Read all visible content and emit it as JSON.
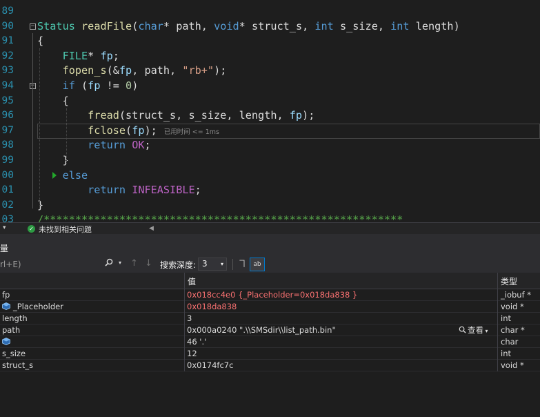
{
  "editor": {
    "lines": [
      {
        "num": "89",
        "tokens": []
      },
      {
        "num": "90",
        "tokens": [
          {
            "t": "Status",
            "c": "t"
          },
          {
            "t": " ",
            "c": ""
          },
          {
            "t": "readFile",
            "c": "f"
          },
          {
            "t": "(",
            "c": ""
          },
          {
            "t": "char",
            "c": "k"
          },
          {
            "t": "* path, ",
            "c": ""
          },
          {
            "t": "void",
            "c": "k"
          },
          {
            "t": "* struct_s, ",
            "c": ""
          },
          {
            "t": "int",
            "c": "k"
          },
          {
            "t": " s_size, ",
            "c": ""
          },
          {
            "t": "int",
            "c": "k"
          },
          {
            "t": " length)",
            "c": ""
          }
        ]
      },
      {
        "num": "91",
        "tokens": [
          {
            "t": "{",
            "c": ""
          }
        ]
      },
      {
        "num": "92",
        "tokens": [
          {
            "t": "    ",
            "c": ""
          },
          {
            "t": "FILE",
            "c": "t"
          },
          {
            "t": "* ",
            "c": ""
          },
          {
            "t": "fp",
            "c": "p"
          },
          {
            "t": ";",
            "c": ""
          }
        ]
      },
      {
        "num": "93",
        "tokens": [
          {
            "t": "    ",
            "c": ""
          },
          {
            "t": "fopen_s",
            "c": "f"
          },
          {
            "t": "(&",
            "c": ""
          },
          {
            "t": "fp",
            "c": "p"
          },
          {
            "t": ", path, ",
            "c": ""
          },
          {
            "t": "\"rb+\"",
            "c": "s"
          },
          {
            "t": ");",
            "c": ""
          }
        ]
      },
      {
        "num": "94",
        "tokens": [
          {
            "t": "    ",
            "c": ""
          },
          {
            "t": "if",
            "c": "k"
          },
          {
            "t": " (",
            "c": ""
          },
          {
            "t": "fp",
            "c": "p"
          },
          {
            "t": " != ",
            "c": ""
          },
          {
            "t": "0",
            "c": "n"
          },
          {
            "t": ")",
            "c": ""
          }
        ]
      },
      {
        "num": "95",
        "tokens": [
          {
            "t": "    {",
            "c": ""
          }
        ]
      },
      {
        "num": "96",
        "tokens": [
          {
            "t": "        ",
            "c": ""
          },
          {
            "t": "fread",
            "c": "f"
          },
          {
            "t": "(struct_s, s_size, length, ",
            "c": ""
          },
          {
            "t": "fp",
            "c": "p"
          },
          {
            "t": ");",
            "c": ""
          }
        ]
      },
      {
        "num": "97",
        "tokens": [
          {
            "t": "        ",
            "c": ""
          },
          {
            "t": "fclose",
            "c": "f"
          },
          {
            "t": "(",
            "c": ""
          },
          {
            "t": "fp",
            "c": "p"
          },
          {
            "t": ");",
            "c": ""
          }
        ],
        "hint": "已用时间 <= 1ms"
      },
      {
        "num": "98",
        "tokens": [
          {
            "t": "        ",
            "c": ""
          },
          {
            "t": "return",
            "c": "k"
          },
          {
            "t": " ",
            "c": ""
          },
          {
            "t": "OK",
            "c": "m"
          },
          {
            "t": ";",
            "c": ""
          }
        ]
      },
      {
        "num": "99",
        "tokens": [
          {
            "t": "    }",
            "c": ""
          }
        ]
      },
      {
        "num": "00",
        "tokens": [
          {
            "t": "    ",
            "c": ""
          },
          {
            "t": "else",
            "c": "k"
          }
        ]
      },
      {
        "num": "01",
        "tokens": [
          {
            "t": "        ",
            "c": ""
          },
          {
            "t": "return",
            "c": "k"
          },
          {
            "t": " ",
            "c": ""
          },
          {
            "t": "INFEASIBLE",
            "c": "m"
          },
          {
            "t": ";",
            "c": ""
          }
        ]
      },
      {
        "num": "02",
        "tokens": [
          {
            "t": "}",
            "c": ""
          }
        ]
      },
      {
        "num": "03",
        "tokens": [
          {
            "t": "/*********************************************************",
            "c": "c"
          }
        ]
      }
    ]
  },
  "statusbar": {
    "issues_text": "未找到相关问题",
    "ok_glyph": "✓",
    "left_arrow": "▾",
    "scroll_arrow": "◀"
  },
  "panel": {
    "title": "量",
    "search_placeholder": "rl+E)",
    "search_icon": "search-icon",
    "depth_label": "搜索深度:",
    "depth_value": "3",
    "pin_label": "ヿ",
    "view_label": "ab"
  },
  "grid": {
    "headers": {
      "name": "",
      "value": "值",
      "type": "类型"
    },
    "rows": [
      {
        "name": "fp",
        "value": "0x018cc4e0 {_Placeholder=0x018da838 }",
        "type": "_iobuf *",
        "changed": true,
        "icon": false
      },
      {
        "name": "_Placeholder",
        "value": "0x018da838",
        "type": "void *",
        "changed": true,
        "icon": true
      },
      {
        "name": "length",
        "value": "3",
        "type": "int",
        "changed": false,
        "icon": false
      },
      {
        "name": "path",
        "value": "0x000a0240 \".\\\\SMSdir\\\\list_path.bin\"",
        "type": "char *",
        "changed": false,
        "icon": false,
        "viewer": "查看"
      },
      {
        "name": "",
        "value": "46 '.'",
        "type": "char",
        "changed": false,
        "icon": true
      },
      {
        "name": "s_size",
        "value": "12",
        "type": "int",
        "changed": false,
        "icon": false
      },
      {
        "name": "struct_s",
        "value": "0x0174fc7c",
        "type": "void *",
        "changed": false,
        "icon": false
      }
    ]
  },
  "colors": {
    "background": "#1e1e1e",
    "keyword": "#569cd6",
    "type": "#4ec9b0",
    "function": "#dcdcaa",
    "string": "#d69d85",
    "changed_value": "#f97171",
    "line_number": "#2b91af"
  }
}
